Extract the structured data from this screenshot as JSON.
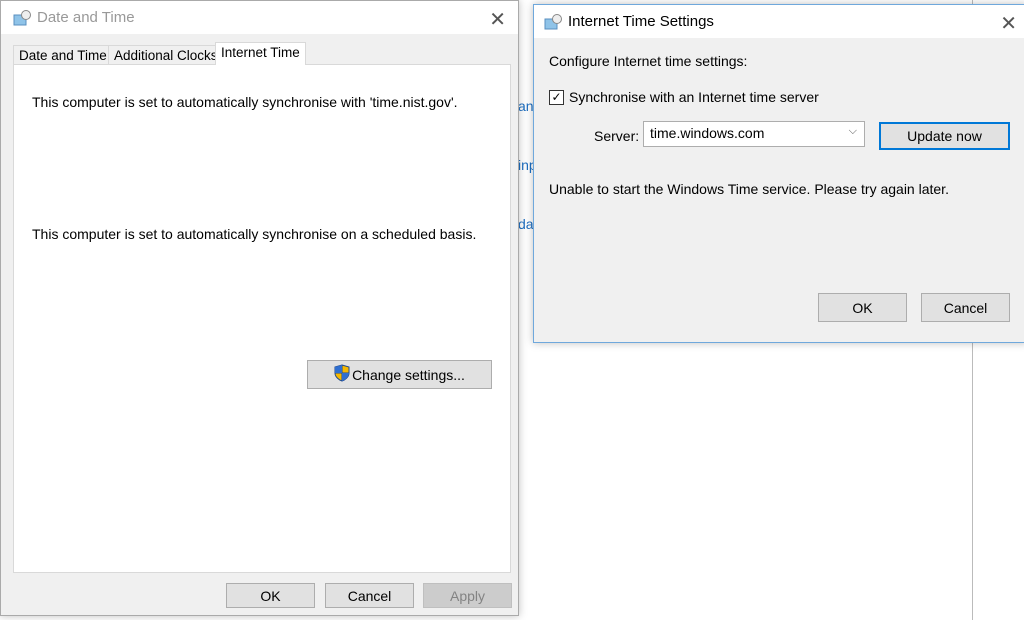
{
  "background": {
    "fragments": [
      "an",
      "inp",
      "da"
    ]
  },
  "date_time_dialog": {
    "title": "Date and Time",
    "tabs": [
      {
        "label": "Date and Time"
      },
      {
        "label": "Additional Clocks"
      },
      {
        "label": "Internet Time",
        "active": true
      }
    ],
    "sync_text": "This computer is set to automatically synchronise with 'time.nist.gov'.",
    "schedule_text": "This computer is set to automatically synchronise on a scheduled basis.",
    "change_settings_label": "Change settings...",
    "ok_label": "OK",
    "cancel_label": "Cancel",
    "apply_label": "Apply"
  },
  "internet_time_dialog": {
    "title": "Internet Time Settings",
    "heading": "Configure Internet time settings:",
    "sync_checkbox_label": "Synchronise with an Internet time server",
    "sync_checked": true,
    "server_label": "Server:",
    "server_value": "time.windows.com",
    "update_label": "Update now",
    "status_text": "Unable to start the Windows Time service. Please try again later.",
    "ok_label": "OK",
    "cancel_label": "Cancel",
    "accent_color": "#0078d7"
  }
}
